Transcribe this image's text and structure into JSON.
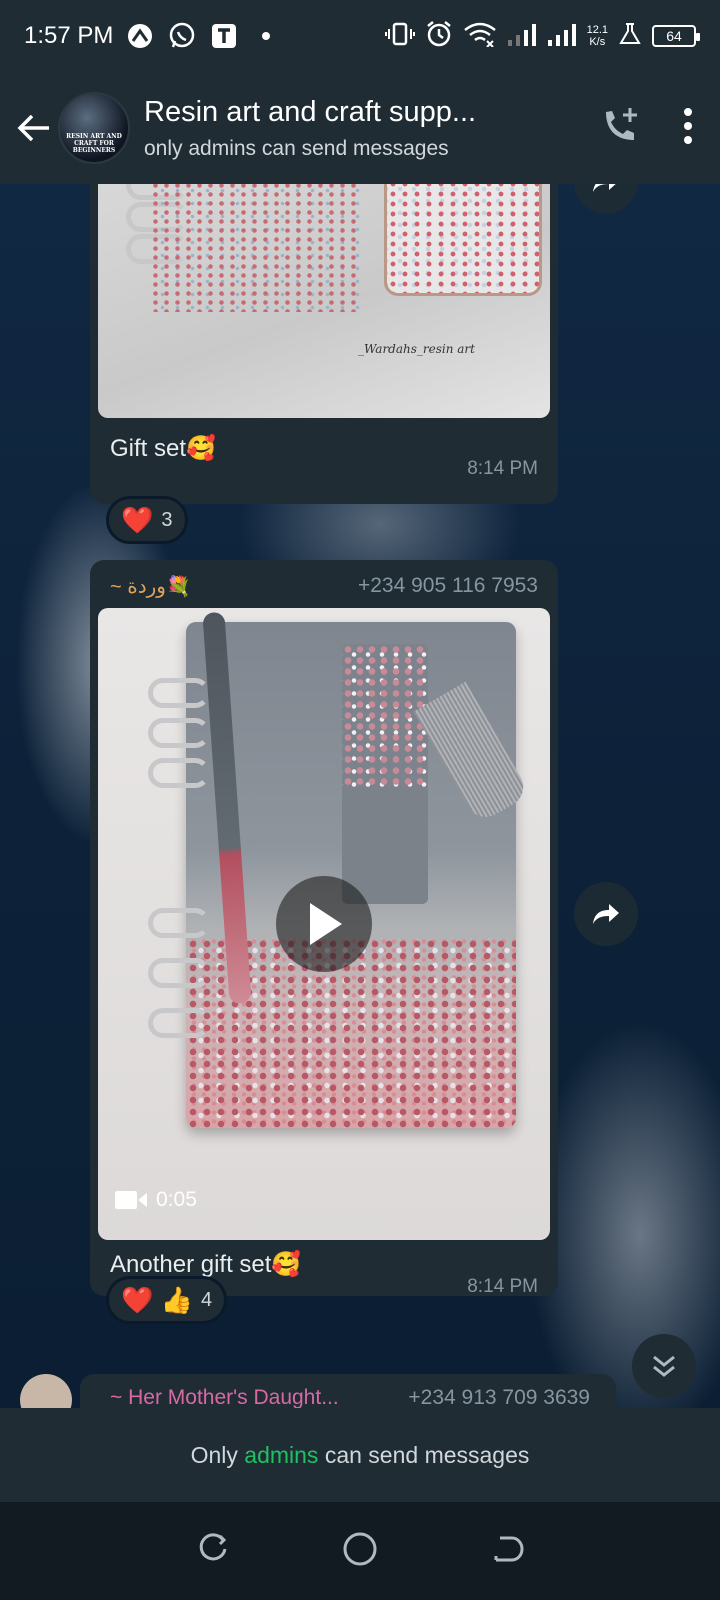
{
  "status_bar": {
    "time": "1:57 PM",
    "net_speed_value": "12.1",
    "net_speed_unit": "K/s",
    "battery": "64"
  },
  "header": {
    "title": "Resin art and craft supp...",
    "subtitle": "only admins can send messages",
    "avatar_text": "RESIN ART AND CRAFT FOR BEGINNERS"
  },
  "messages": [
    {
      "caption": "Gift set🥰",
      "time": "8:14 PM",
      "image_watermark": "_Wardahs_resin art",
      "reactions": {
        "emojis": "❤️",
        "count": "3"
      }
    },
    {
      "sender_name": "~ وردة💐",
      "sender_phone": "+234 905 116 7953",
      "video_duration": "0:05",
      "caption": "Another gift set🥰",
      "time": "8:14 PM",
      "reactions": {
        "emojis": "❤️ 👍",
        "count": "4"
      }
    },
    {
      "sender_name": "~ Her Mother's Daught...",
      "sender_phone": "+234 913 709 3639"
    }
  ],
  "footer": {
    "prefix": "Only",
    "link": "admins",
    "suffix": "can send messages"
  },
  "colors": {
    "header_bg": "#1f2c34",
    "bubble_bg": "#1f2c34",
    "accent_green": "#21c063",
    "sender_name_pink": "#d769a5",
    "sender_name_orange": "#e0a35b"
  }
}
